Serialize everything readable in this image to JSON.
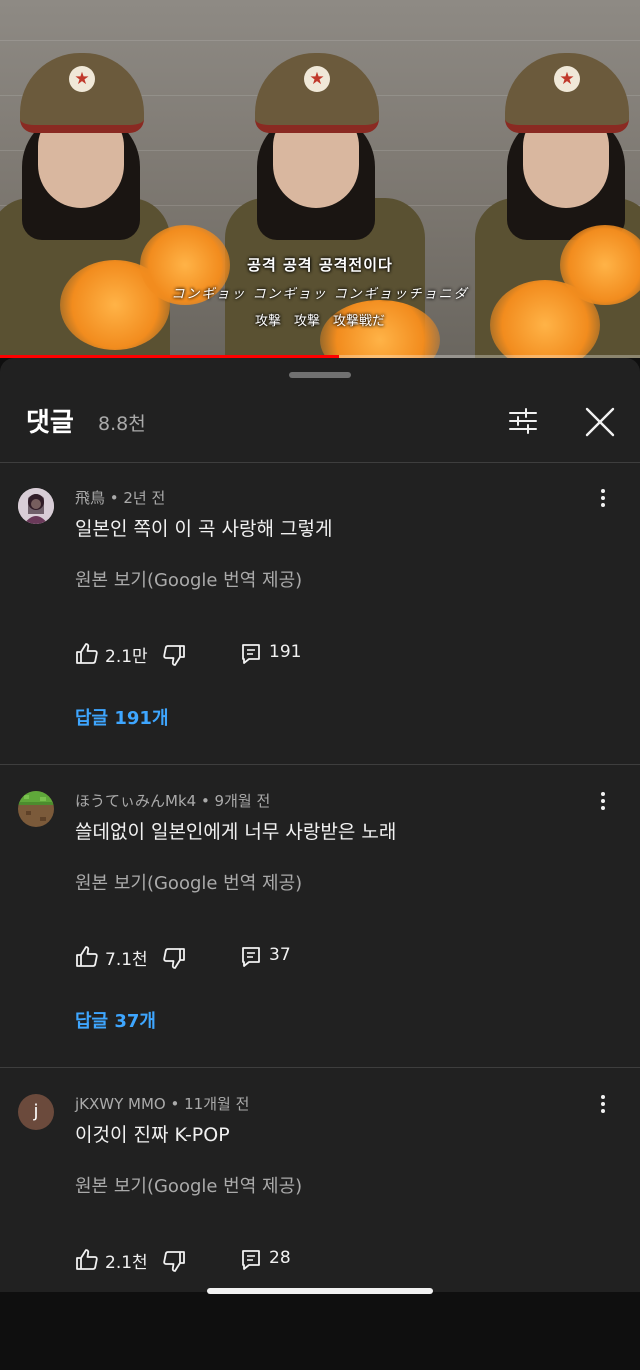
{
  "video": {
    "subtitle_korean": "공격 공격 공격전이다",
    "subtitle_katakana": "コンギョッ コンギョッ コンギョッチョニダ",
    "subtitle_kanji": "攻撃　攻撃　攻撃戦だ",
    "progress_fraction": 0.53,
    "progress_color": "#ff0000"
  },
  "header": {
    "title": "댓글",
    "count": "8.8천",
    "filter_icon": "sliders-icon",
    "close_icon": "close-icon"
  },
  "comments": [
    {
      "author": "飛鳥",
      "time": "2년 전",
      "meta": "飛鳥 • 2년 전",
      "text": "일본인 쪽이 이 곡 사랑해 그렇게",
      "translate": "원본 보기(Google 번역 제공)",
      "likes": "2.1만",
      "replies_count": "191",
      "replies_link": "답글 191개"
    },
    {
      "author": "ほうてぃみんMk4",
      "time": "9개월 전",
      "meta": "ほうてぃみんMk4 • 9개월 전",
      "text": "쓸데없이 일본인에게 너무 사랑받은 노래",
      "translate": "원본 보기(Google 번역 제공)",
      "likes": "7.1천",
      "replies_count": "37",
      "replies_link": "답글 37개"
    },
    {
      "author": "jKXWY MMO",
      "time": "11개월 전",
      "meta": "jKXWY MMO • 11개월 전",
      "avatar_letter": "j",
      "text": "이것이 진짜 K-POP",
      "translate": "원본 보기(Google 번역 제공)",
      "likes": "2.1천",
      "replies_count": "28"
    }
  ],
  "colors": {
    "sheet_bg": "#212121",
    "link_blue": "#3ea6ff",
    "avatar_j_bg": "#6b4a3c"
  }
}
